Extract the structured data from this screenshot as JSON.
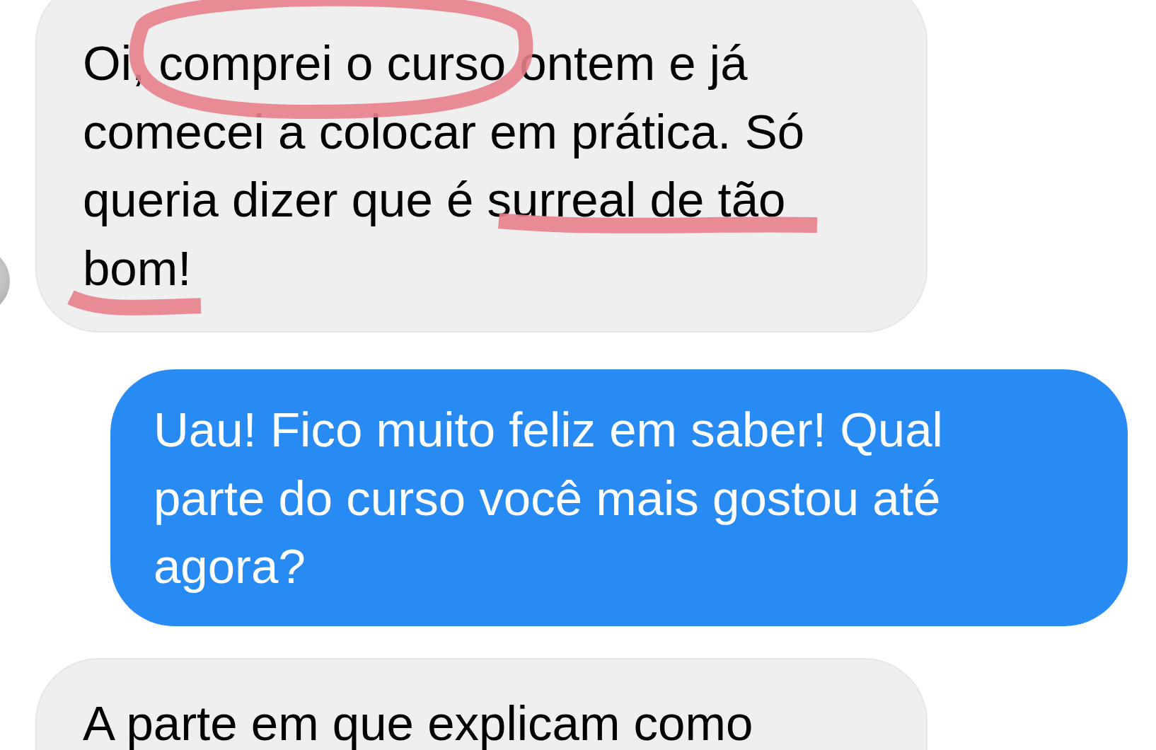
{
  "messages": [
    {
      "kind": "received",
      "text": "Oi, comprei o curso ontem e já comecei a colocar em prática. Só queria dizer que é surreal de tão bom!",
      "avatar": true
    },
    {
      "kind": "sent",
      "text": "Uau! Fico muito feliz em saber! Qual parte do curso você mais gostou até agora?",
      "avatar": false
    },
    {
      "kind": "received",
      "text": "A parte em que explicam como",
      "avatar": false
    }
  ],
  "annotations": [
    {
      "kind": "circle"
    },
    {
      "kind": "underline"
    },
    {
      "kind": "underline"
    }
  ]
}
